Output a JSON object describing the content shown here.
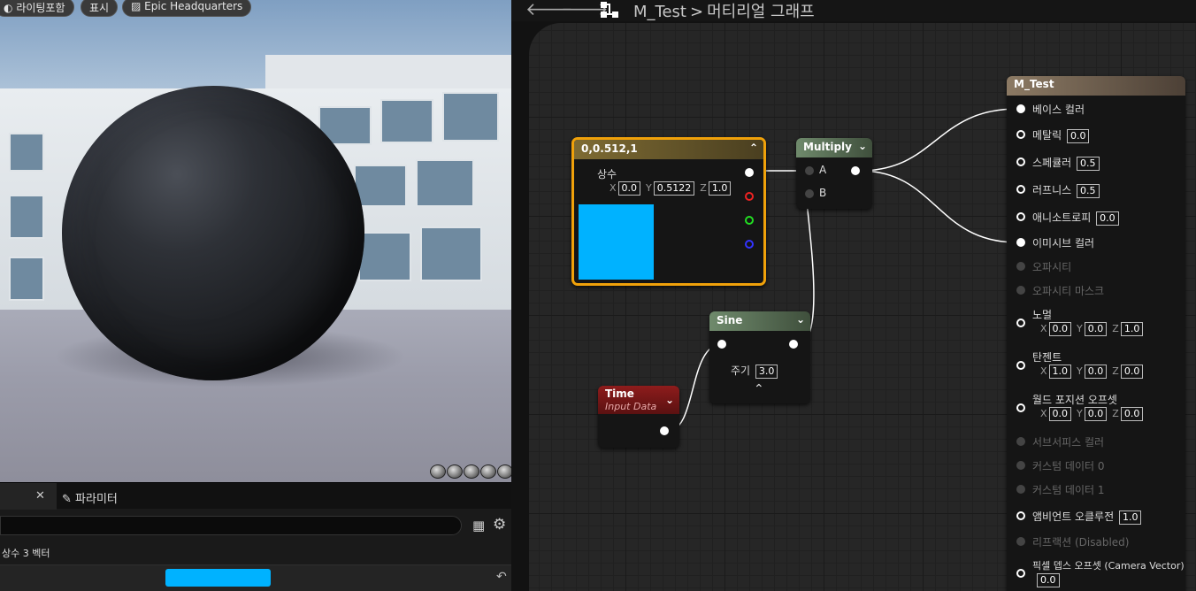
{
  "viewport": {
    "buttons": [
      "라이팅포함",
      "표시",
      "Epic Headquarters"
    ]
  },
  "details": {
    "params_tab": "파라미터",
    "category_label": "상수 3 벡터",
    "swatch_color": "#00b2ff"
  },
  "graph": {
    "breadcrumb_root": "M_Test",
    "breadcrumb_sep": ">",
    "breadcrumb_current": "머티리얼 그래프",
    "const_node": {
      "title": "0,0.512,1",
      "label": "상수",
      "x_axis": "X",
      "x": "0.0",
      "y_axis": "Y",
      "y": "0.5122",
      "z_axis": "Z",
      "z": "1.0",
      "preview_color": "#00b2ff"
    },
    "multiply_node": {
      "title": "Multiply",
      "in_a": "A",
      "in_b": "B"
    },
    "sine_node": {
      "title": "Sine",
      "period_label": "주기",
      "period": "3.0"
    },
    "time_node": {
      "title": "Time",
      "subtitle": "Input Data"
    },
    "material_node": {
      "title": "M_Test",
      "base_color": "베이스 컬러",
      "metallic": "메탈릭",
      "metallic_val": "0.0",
      "specular": "스페큘러",
      "specular_val": "0.5",
      "roughness": "러프니스",
      "roughness_val": "0.5",
      "anisotropy": "애니소트로피",
      "anisotropy_val": "0.0",
      "emissive": "이미시브 컬러",
      "opacity": "오파시티",
      "opacity_mask": "오파시티 마스크",
      "normal": "노멀",
      "normal_x": "0.0",
      "normal_y": "0.0",
      "normal_z": "1.0",
      "tangent": "탄젠트",
      "tangent_x": "1.0",
      "tangent_y": "0.0",
      "tangent_z": "0.0",
      "wpo": "월드 포지션 오프셋",
      "wpo_x": "0.0",
      "wpo_y": "0.0",
      "wpo_z": "0.0",
      "subsurface": "서브서피스 컬러",
      "custom0": "커스텀 데이터 0",
      "custom1": "커스텀 데이터 1",
      "ao": "앰비언트 오클루전",
      "ao_val": "1.0",
      "refraction": "리프랙션 (Disabled)",
      "pdo": "픽셀 뎁스 오프셋 (Camera Vector)",
      "pdo_val": "0.0"
    }
  }
}
